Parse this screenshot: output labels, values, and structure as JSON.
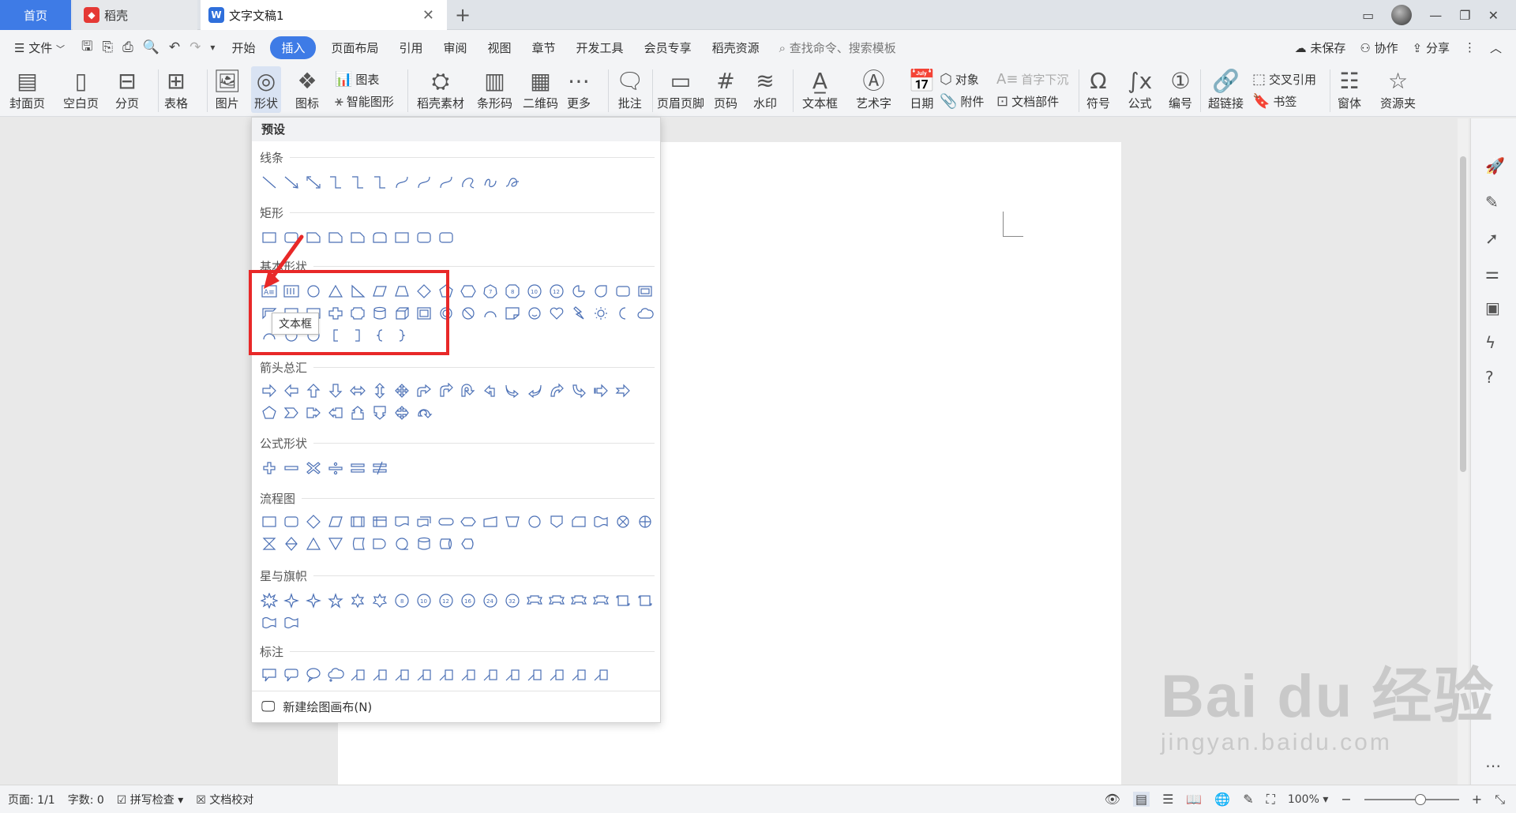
{
  "tabs": {
    "home": "首页",
    "daoke": "稻壳",
    "document": "文字文稿1",
    "add": "+"
  },
  "menubar": {
    "file": "文件",
    "items": [
      "开始",
      "插入",
      "页面布局",
      "引用",
      "审阅",
      "视图",
      "章节",
      "开发工具",
      "会员专享",
      "稻壳资源"
    ],
    "active_index": 1,
    "search_placeholder": "查找命令、搜索模板",
    "unsaved": "未保存",
    "collaborate": "协作",
    "share": "分享"
  },
  "ribbon": {
    "cover": "封面页",
    "blank": "空白页",
    "pagebreak": "分页",
    "table": "表格",
    "picture": "图片",
    "shape": "形状",
    "icon": "图标",
    "chart": "图表",
    "smartart": "智能图形",
    "daoke_material": "稻壳素材",
    "barcode": "条形码",
    "qrcode": "二维码",
    "more": "更多",
    "comment": "批注",
    "header_footer": "页眉页脚",
    "page_number": "页码",
    "watermark": "水印",
    "textbox": "文本框",
    "wordart": "艺术字",
    "date": "日期",
    "object": "对象",
    "dropcap": "首字下沉",
    "attachment": "附件",
    "doc_parts": "文档部件",
    "symbol": "符号",
    "formula": "公式",
    "numbering": "编号",
    "hyperlink": "超链接",
    "crossref": "交叉引用",
    "bookmark": "书签",
    "window": "窗体",
    "resource": "资源夹"
  },
  "dropdown": {
    "header": "预设",
    "categories": [
      "线条",
      "矩形",
      "基本形状",
      "箭头总汇",
      "公式形状",
      "流程图",
      "星与旗帜",
      "标注"
    ],
    "tooltip": "文本框",
    "footer": "新建绘图画布(N)"
  },
  "statusbar": {
    "page": "页面: 1/1",
    "words": "字数: 0",
    "spellcheck": "拼写检查",
    "proofread": "文档校对",
    "zoom": "100%"
  },
  "watermark": {
    "brand": "Bai du 经验",
    "url": "jingyan.baidu.com"
  },
  "colors": {
    "accent": "#3e7be6",
    "highlight": "#e82828",
    "shape_stroke": "#4a6fb5"
  }
}
